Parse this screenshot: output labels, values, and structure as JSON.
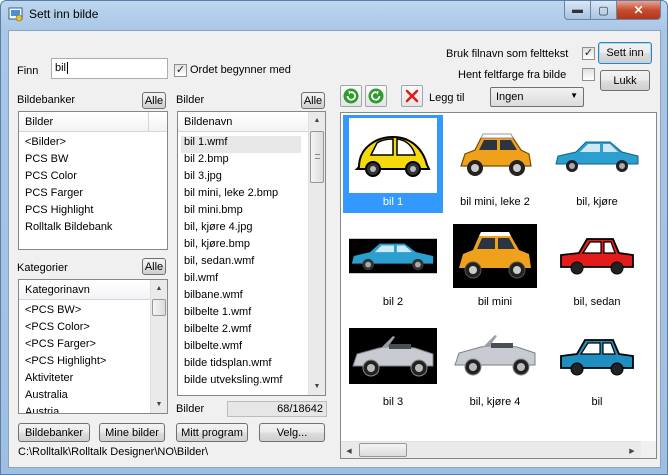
{
  "window": {
    "title": "Sett inn bilde",
    "min_glyph": "▬",
    "max_glyph": "▢",
    "close_glyph": "✕"
  },
  "search": {
    "label": "Finn",
    "value": "bil",
    "starts_with_checked": true,
    "starts_with_label": "Ordet begynner med"
  },
  "options": {
    "use_filename_checked": true,
    "use_filename_label": "Bruk filnavn som felttekst",
    "fetch_color_checked": false,
    "fetch_color_label": "Hent feltfarge fra bilde",
    "check_mark": "✓"
  },
  "buttons": {
    "insert": "Sett inn",
    "close": "Lukk",
    "alle_banks": "Alle",
    "alle_images": "Alle",
    "alle_categories": "Alle",
    "bildebanker": "Bildebanker",
    "mine_bilder": "Mine bilder",
    "mitt_program": "Mitt program",
    "velg": "Velg..."
  },
  "banks": {
    "label": "Bildebanker",
    "header": "Bilder",
    "items": [
      "<Bilder>",
      "PCS BW",
      "PCS Color",
      "PCS Farger",
      "PCS Highlight",
      "Rolltalk Bildebank"
    ]
  },
  "categories": {
    "label": "Kategorier",
    "header": "Kategorinavn",
    "items": [
      "<PCS BW>",
      "<PCS Color>",
      "<PCS Farger>",
      "<PCS Highlight>",
      "Aktiviteter",
      "Australia",
      "Austria"
    ]
  },
  "images": {
    "label": "Bilder",
    "header": "Bildenavn",
    "items": [
      "bil 1.wmf",
      "bil 2.bmp",
      "bil 3.jpg",
      "bil mini, leke 2.bmp",
      "bil mini.bmp",
      "bil, kjøre 4.jpg",
      "bil, kjøre.bmp",
      "bil, sedan.wmf",
      "bil.wmf",
      "bilbane.wmf",
      "bilbelte 1.wmf",
      "bilbelte 2.wmf",
      "bilbelte.wmf",
      "bilde tidsplan.wmf",
      "bilde utveksling.wmf"
    ],
    "count_label": "Bilder",
    "count_value": "68/18642"
  },
  "toolbar": {
    "add_to_label": "Legg til",
    "add_to_value": "Ingen",
    "undo_icon": "undo-icon",
    "redo_icon": "redo-icon",
    "delete_icon": "delete-icon"
  },
  "gallery": {
    "tiles": [
      {
        "caption": "bil 1",
        "icon": "yellow-beetle-car",
        "selected": true
      },
      {
        "caption": "bil mini, leke 2",
        "icon": "orange-mini-car",
        "selected": false
      },
      {
        "caption": "bil, kjøre",
        "icon": "blue-sedan-photo",
        "selected": false
      },
      {
        "caption": "bil 2",
        "icon": "blue-sedan-photo-dark",
        "selected": false
      },
      {
        "caption": "bil mini",
        "icon": "orange-mini-car-dark",
        "selected": false
      },
      {
        "caption": "bil, sedan",
        "icon": "red-sedan-car",
        "selected": false
      },
      {
        "caption": "bil 3",
        "icon": "silver-convertible-dark",
        "selected": false
      },
      {
        "caption": "bil, kjøre 4",
        "icon": "silver-convertible",
        "selected": false
      },
      {
        "caption": "bil",
        "icon": "blue-sedan-car",
        "selected": false
      }
    ]
  },
  "status": {
    "path": "C:\\Rolltalk\\Rolltalk Designer\\NO\\Bilder\\"
  },
  "colors": {
    "selection": "#3399ff",
    "window_bg": "#f0f0f0"
  }
}
